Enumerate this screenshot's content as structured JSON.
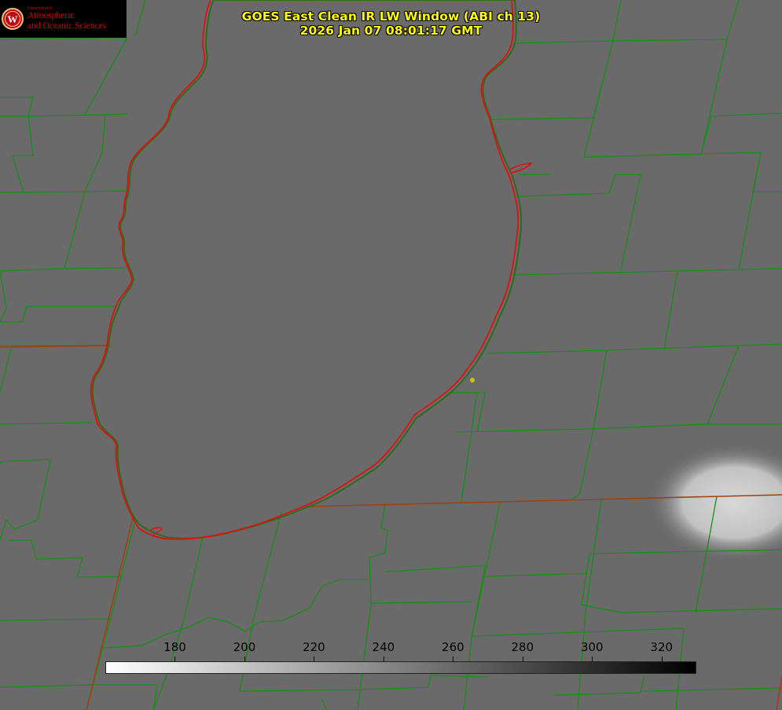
{
  "logo": {
    "department": "Department of",
    "line1": "Atmospheric",
    "line2": "and Oceanic Sciences",
    "seal_letter": "W"
  },
  "title": {
    "line1": "GOES East Clean IR LW Window (ABI ch 13)",
    "line2": "2026 Jan 07 08:01:17 GMT"
  },
  "colorbar": {
    "min": 160,
    "max": 330,
    "ticks": [
      "180",
      "200",
      "220",
      "240",
      "260",
      "280",
      "300",
      "320"
    ],
    "tick_values": [
      180,
      200,
      220,
      240,
      260,
      280,
      300,
      320
    ],
    "gradient": [
      "#ffffff",
      "#000000"
    ]
  },
  "colors": {
    "background_gray": "#6a6a6a",
    "county_lines": "#1a8c1a",
    "coastline": "#e01010",
    "title_text": "#ffff00",
    "marker": "#c8c800"
  },
  "map": {
    "feature": "lake outline",
    "marker": "yellow dot"
  }
}
